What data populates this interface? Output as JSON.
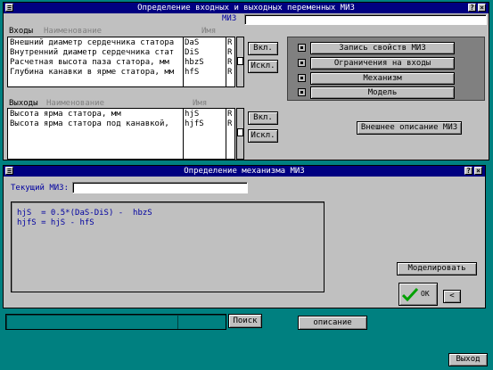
{
  "main_window": {
    "title": "Определение входных и выходных переменных МИЗ",
    "miz_label": "МИЗ",
    "inputs_label": "Входы",
    "name_header": "Наименование",
    "id_header": "Имя",
    "inputs": [
      {
        "name": "Внешний диаметр сердечника статора",
        "id": "DaS",
        "flag": "R"
      },
      {
        "name": "Внутренний диаметр сердечника стат",
        "id": "DiS",
        "flag": "R"
      },
      {
        "name": "Расчетная высота паза статора, мм",
        "id": "hbzS",
        "flag": "R"
      },
      {
        "name": "Глубина канавки в ярме статора, мм",
        "id": "hfS",
        "flag": "R"
      }
    ],
    "outputs_label": "Выходы",
    "outputs": [
      {
        "name": "Высота ярма статора, мм",
        "id": "hjS",
        "flag": "R"
      },
      {
        "name": "Высота ярма статора под канавкой,",
        "id": "hjfS",
        "flag": "R"
      }
    ],
    "include_label": "Вкл.",
    "exclude_label": "Искл.",
    "side_buttons": [
      "Запись свойств МИЗ",
      "Ограничения на входы",
      "Механизм",
      "Модель"
    ],
    "external_description_label": "Внешнее описание МИЗ"
  },
  "mech_window": {
    "title": "Определение механизма МИЗ",
    "current_miz_label": "Текущий МИЗ:",
    "current_miz_value": "",
    "code_lines": [
      "hjS  = 0.5*(DaS-DiS) -  hbzS",
      "hjfS = hjS - hfS"
    ],
    "model_button": "Моделировать",
    "ok_label": "OK",
    "back_label": "<"
  },
  "bottom": {
    "search_label": "Поиск",
    "description_label": "описание",
    "exit_label": "Выход"
  },
  "sys_buttons": {
    "help": "?",
    "close": "×",
    "menu": "≡"
  }
}
